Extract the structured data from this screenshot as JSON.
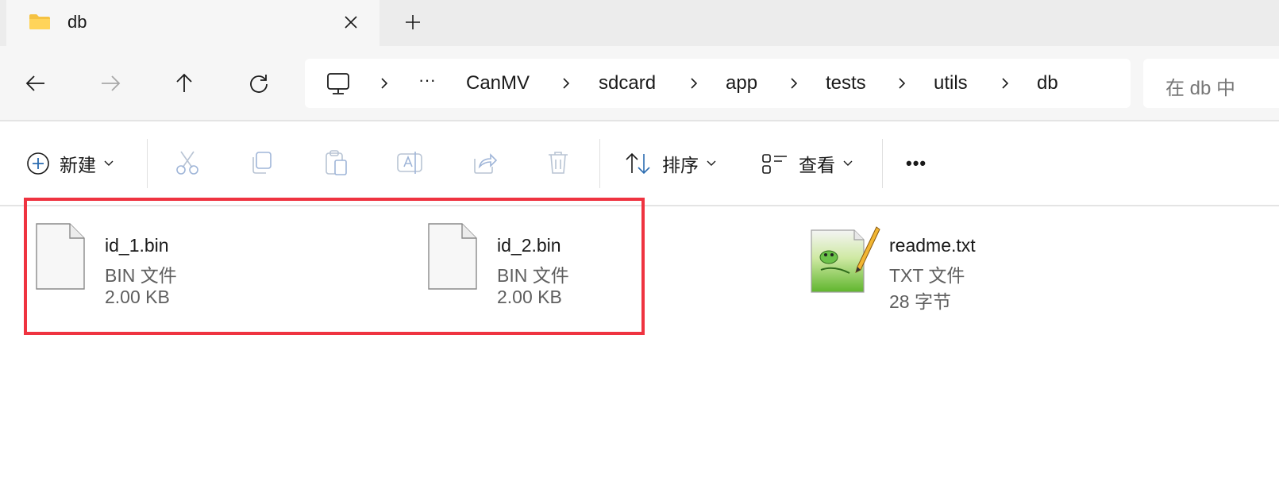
{
  "tab": {
    "title": "db",
    "close_icon": "close-icon",
    "new_tab_icon": "plus-icon"
  },
  "nav": {
    "back": "arrow-left-icon",
    "forward": "arrow-right-icon",
    "up": "arrow-up-icon",
    "refresh": "refresh-icon"
  },
  "address": {
    "ellipsis": "···",
    "crumbs": [
      "CanMV",
      "sdcard",
      "app",
      "tests",
      "utils",
      "db"
    ]
  },
  "search": {
    "placeholder": "在 db 中"
  },
  "toolbar": {
    "new_label": "新建",
    "sort_label": "排序",
    "view_label": "查看",
    "more_label": "•••"
  },
  "files": [
    {
      "name": "id_1.bin",
      "type": "BIN 文件",
      "size": "2.00 KB",
      "icon": "blank-file-icon"
    },
    {
      "name": "id_2.bin",
      "type": "BIN 文件",
      "size": "2.00 KB",
      "icon": "blank-file-icon"
    },
    {
      "name": "readme.txt",
      "type": "TXT 文件",
      "size": "28 字节",
      "icon": "notepadpp-file-icon"
    }
  ],
  "colors": {
    "highlight": "#ef3340",
    "folder": "#f5c242",
    "accent": "#2b6cb0"
  }
}
